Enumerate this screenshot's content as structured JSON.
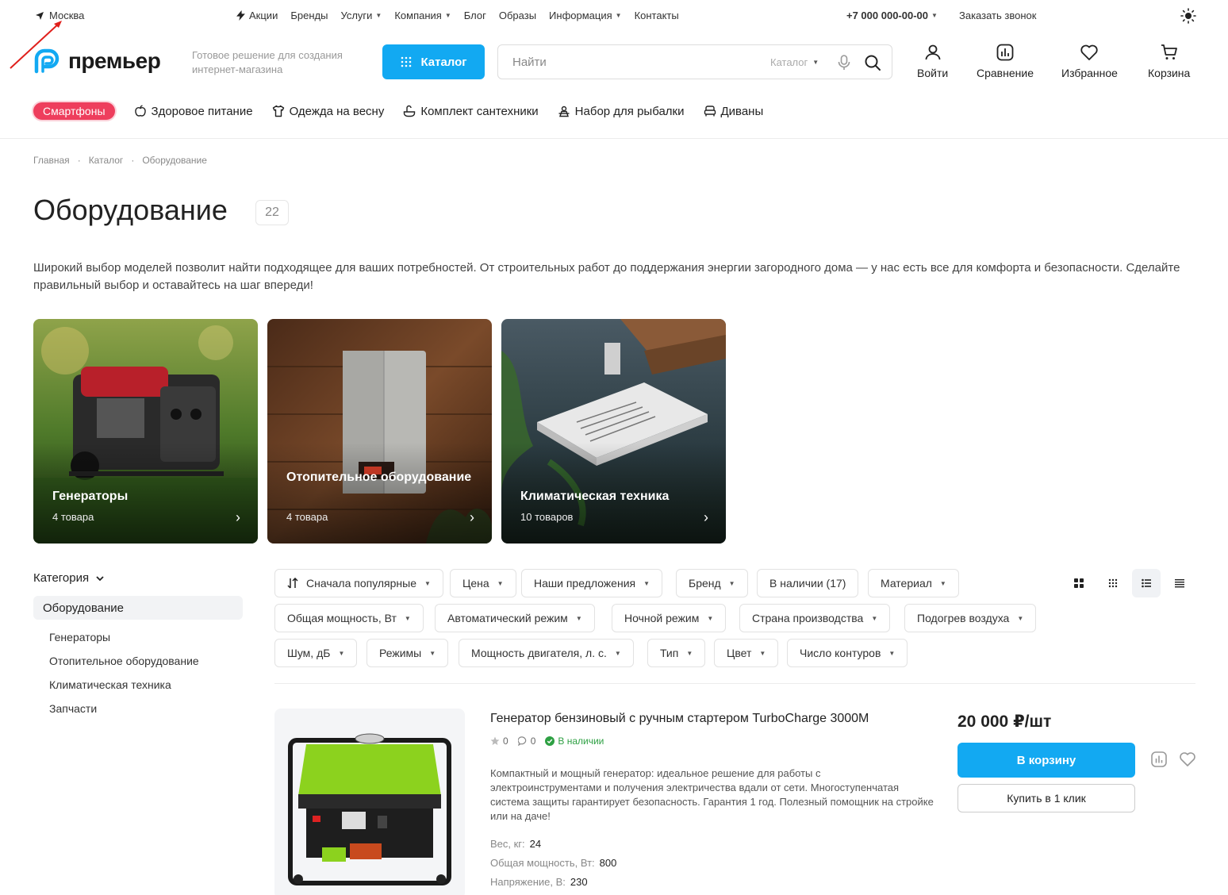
{
  "topbar": {
    "city": "Москва",
    "nav": [
      {
        "label": "Акции",
        "has_icon": true
      },
      {
        "label": "Бренды"
      },
      {
        "label": "Услуги",
        "dropdown": true
      },
      {
        "label": "Компания",
        "dropdown": true
      },
      {
        "label": "Блог"
      },
      {
        "label": "Образы"
      },
      {
        "label": "Информация",
        "dropdown": true
      },
      {
        "label": "Контакты"
      }
    ],
    "phone": "+7 000 000-00-00",
    "callback": "Заказать звонок"
  },
  "header": {
    "logo": "премьер",
    "tagline": "Готовое решение для создания интернет-магазина",
    "catalog_button": "Каталог",
    "search_placeholder": "Найти",
    "search_scope": "Каталог",
    "actions": {
      "login": "Войти",
      "compare": "Сравнение",
      "favorites": "Избранное",
      "cart": "Корзина"
    }
  },
  "chips": {
    "hot": "Смартфоны",
    "items": [
      "Здоровое питание",
      "Одежда на весну",
      "Комплект сантехники",
      "Набор для рыбалки",
      "Диваны"
    ]
  },
  "breadcrumb": [
    "Главная",
    "Каталог",
    "Оборудование"
  ],
  "page": {
    "title": "Оборудование",
    "count": "22",
    "description": "Широкий выбор моделей позволит найти подходящее для ваших потребностей. От строительных работ до поддержания энергии загородного дома — у нас есть все для комфорта и безопасности. Сделайте правильный выбор и оставайтесь на шаг впереди!"
  },
  "categories": [
    {
      "title": "Генераторы",
      "count": "4 товара"
    },
    {
      "title": "Отопительное оборудование",
      "count": "4 товара"
    },
    {
      "title": "Климатическая техника",
      "count": "10 товаров"
    }
  ],
  "sidebar": {
    "heading": "Категория",
    "active": "Оборудование",
    "items": [
      "Генераторы",
      "Отопительное оборудование",
      "Климатическая техника",
      "Запчасти"
    ]
  },
  "filters": {
    "sort": "Сначала популярные",
    "row1": [
      "Цена",
      "Наши предложения",
      "Бренд",
      "В наличии (17)",
      "Материал"
    ],
    "row2": [
      "Общая мощность, Вт",
      "Автоматический режим",
      "Ночной режим",
      "Страна производства",
      "Подогрев воздуха"
    ],
    "row3": [
      "Шум, дБ",
      "Режимы",
      "Мощность двигателя, л. с.",
      "Тип",
      "Цвет",
      "Число контуров"
    ]
  },
  "product": {
    "title": "Генератор бензиновый с ручным стартером TurboCharge 3000M",
    "rating": "0",
    "reviews": "0",
    "stock": "В наличии",
    "description": "Компактный и мощный генератор: идеальное решение для работы с электроинструментами и получения электричества вдали от сети. Многоступенчатая система защиты гарантирует безопасность. Гарантия 1 год. Полезный помощник на стройке или на даче!",
    "specs": [
      {
        "label": "Вес, кг:",
        "value": "24"
      },
      {
        "label": "Общая мощность, Вт:",
        "value": "800"
      },
      {
        "label": "Напряжение, В:",
        "value": "230"
      }
    ],
    "price": "20 000 ₽/шт",
    "cart_button": "В корзину",
    "buy_one_click": "Купить в 1 клик"
  },
  "colors": {
    "accent": "#12a9f2",
    "hot": "#ee3e5d",
    "instock": "#2ea043"
  }
}
